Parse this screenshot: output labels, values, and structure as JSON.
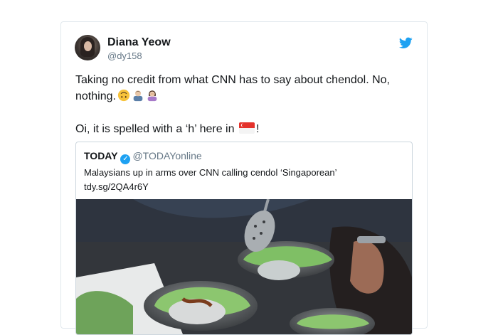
{
  "author": {
    "name": "Diana Yeow",
    "handle": "@dy158"
  },
  "tweet": {
    "line1": "Taking no credit from what CNN has to say about chendol. No, nothing.",
    "line2_before": "Oi, it is spelled with a ‘h’ here in ",
    "line2_after": "!"
  },
  "icons": {
    "platform": "twitter-bird-icon",
    "emojis": [
      "upside-down-face-emoji",
      "man-shrugging-emoji",
      "woman-facepalming-emoji",
      "singapore-flag-emoji"
    ]
  },
  "quoted": {
    "name": "TODAY",
    "handle": "@TODAYonline",
    "headline": "Malaysians up in arms over CNN calling cendol ‘Singaporean’",
    "link": "tdy.sg/2QA4r6Y"
  },
  "colors": {
    "twitter_blue": "#1da1f2",
    "text": "#14171a",
    "secondary": "#657786",
    "border": "#e1e8ed"
  }
}
